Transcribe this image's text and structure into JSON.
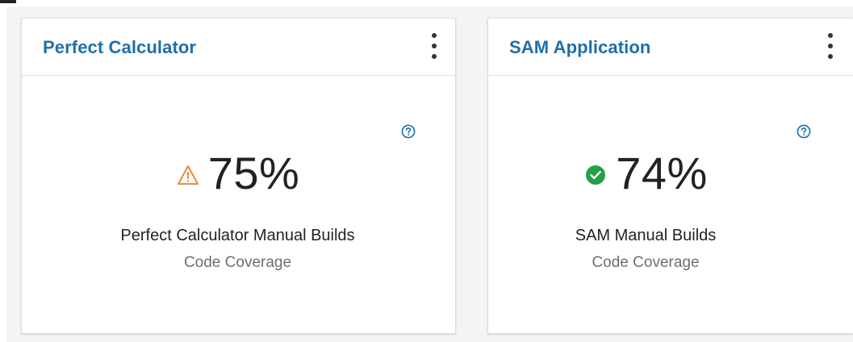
{
  "cards": [
    {
      "title": "Perfect Calculator",
      "menu_icon": "overflow-menu-vertical-icon",
      "help_icon": "help-icon",
      "status_icon": "warning-triangle-icon",
      "status_color": "#f08a38",
      "value": "75%",
      "label": "Perfect Calculator Manual Builds",
      "metric": "Code Coverage"
    },
    {
      "title": "SAM Application",
      "menu_icon": "overflow-menu-vertical-icon",
      "help_icon": "help-icon",
      "status_icon": "checkmark-filled-icon",
      "status_color": "#24a148",
      "value": "74%",
      "label": "SAM Manual Builds",
      "metric": "Code Coverage"
    }
  ],
  "colors": {
    "title": "#1f6fa8",
    "help": "#1f6fa8",
    "value_text": "#222222",
    "subtext": "#6f6f6f"
  }
}
